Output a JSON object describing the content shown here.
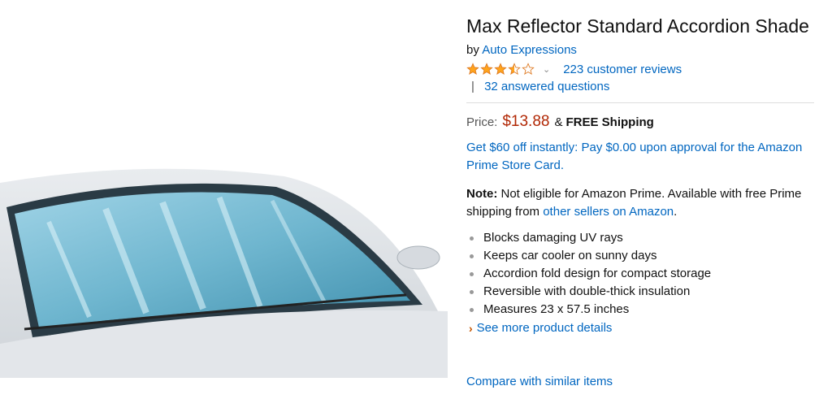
{
  "product": {
    "title": "Max Reflector Standard Accordion Shade",
    "by_prefix": "by",
    "brand": "Auto Expressions",
    "rating": 3.5,
    "rating_max": 5,
    "reviews_link": "223 customer reviews",
    "qa_separator": "|",
    "qa_link": "32 answered questions"
  },
  "price": {
    "label": "Price:",
    "value": "$13.88",
    "amp": "&",
    "shipping": "FREE Shipping"
  },
  "promo": {
    "text": "Get $60 off instantly: Pay $0.00 upon approval for the Amazon Prime Store Card."
  },
  "note": {
    "label": "Note:",
    "text_before": " Not eligible for Amazon Prime. Available with free Prime shipping from ",
    "link": "other sellers on Amazon",
    "text_after": "."
  },
  "bullets": [
    "Blocks damaging UV rays",
    "Keeps car cooler on sunny days",
    "Accordion fold design for compact storage",
    "Reversible with double-thick insulation",
    "Measures 23 x 57.5 inches"
  ],
  "more_link": "See more product details",
  "compare_link": "Compare with similar items",
  "colors": {
    "link": "#0066c0",
    "price": "#B12704",
    "star": "#FFA41C",
    "arrow": "#c45500"
  },
  "icons": {
    "rating": "star-icon",
    "dropdown": "chevron-down-icon",
    "more": "chevron-right-icon"
  }
}
